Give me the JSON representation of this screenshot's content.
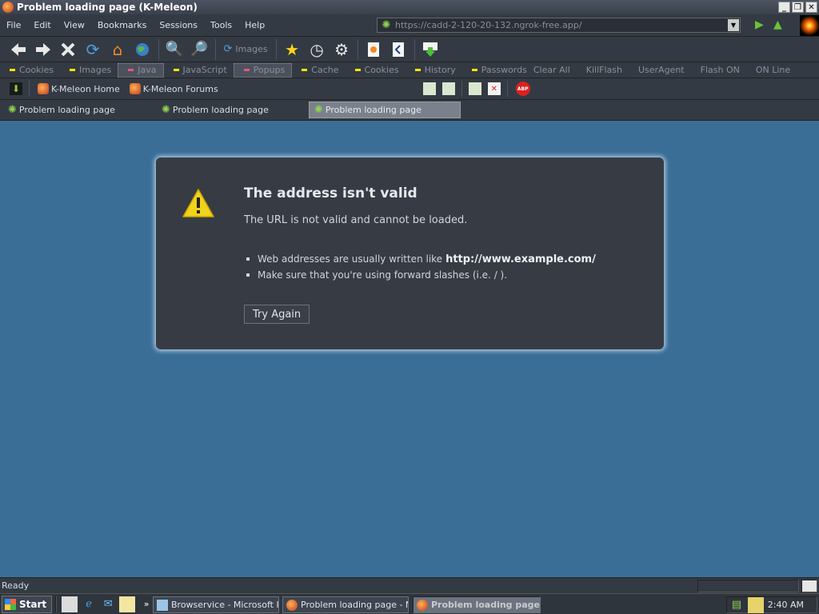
{
  "window": {
    "title": "Problem loading page (K-Meleon)",
    "controls": [
      "_",
      "❐",
      "✕"
    ]
  },
  "menu": [
    "File",
    "Edit",
    "View",
    "Bookmarks",
    "Sessions",
    "Tools",
    "Help"
  ],
  "url_bar": {
    "value": "https://cadd-2-120-20-132.ngrok-free.app/"
  },
  "toolbar": {
    "images_label": "Images"
  },
  "toggles": [
    {
      "label": "Cookies",
      "pressed": false
    },
    {
      "label": "Images",
      "pressed": false
    },
    {
      "label": "Java",
      "pressed": true
    },
    {
      "label": "JavaScript",
      "pressed": false
    },
    {
      "label": "Popups",
      "pressed": true
    },
    {
      "label": "Cache",
      "pressed": false
    },
    {
      "label": "Cookies",
      "pressed": false
    },
    {
      "label": "History",
      "pressed": false
    },
    {
      "label": "Passwords",
      "pressed": false
    },
    {
      "label": "Clear All",
      "pressed": false
    },
    {
      "label": "KillFlash",
      "pressed": false
    },
    {
      "label": "UserAgent",
      "pressed": false
    },
    {
      "label": "Flash ON",
      "pressed": false
    },
    {
      "label": "ON Line",
      "pressed": false
    }
  ],
  "bookmarks": [
    "K-Meleon Home",
    "K-Meleon Forums"
  ],
  "tabs": [
    {
      "label": "Problem loading page",
      "active": false
    },
    {
      "label": "Problem loading page",
      "active": false
    },
    {
      "label": "Problem loading page",
      "active": true
    }
  ],
  "error": {
    "title": "The address isn't valid",
    "description": "The URL is not valid and cannot be loaded.",
    "hint1_text": "Web addresses are usually written like",
    "hint1_example": "http://www.example.com/",
    "hint2": "Make sure that you're using forward slashes (i.e. / ).",
    "button": "Try Again"
  },
  "status": {
    "text": "Ready"
  },
  "taskbar": {
    "start": "Start",
    "tasks": [
      {
        "label": "Browservice - Microsoft I...",
        "active": false
      },
      {
        "label": "Problem loading page - M...",
        "active": false
      },
      {
        "label": "Problem loading page ...",
        "active": true
      }
    ],
    "clock": "2:40 AM"
  }
}
